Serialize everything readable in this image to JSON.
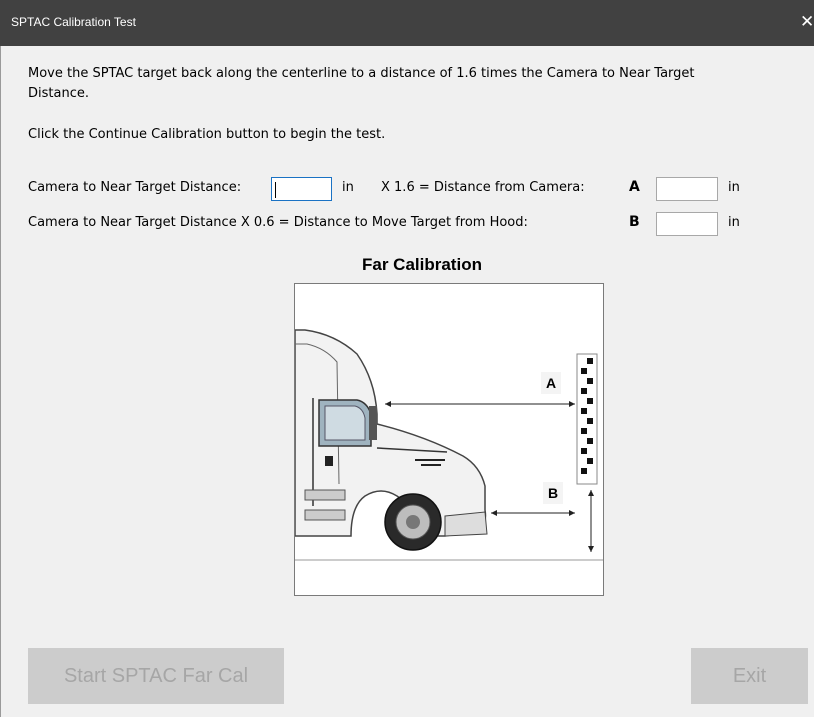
{
  "window": {
    "title": "SPTAC Calibration Test",
    "close_glyph": "✕"
  },
  "instructions": {
    "line1": "Move the SPTAC target back along the centerline to a distance of 1.6 times the Camera to Near Target",
    "line1_cont": "Distance.",
    "line2": "Click the Continue Calibration button to begin the test."
  },
  "row1": {
    "label": "Camera to Near Target Distance:",
    "input_value": "",
    "unit": "in",
    "formula": "X 1.6 = Distance from Camera:",
    "letter": "A",
    "result_value": "",
    "result_unit": "in"
  },
  "row2": {
    "label": "Camera to Near Target Distance X 0.6 = Distance to Move Target from Hood:",
    "letter": "B",
    "result_value": "",
    "result_unit": "in"
  },
  "figure": {
    "title": "Far Calibration",
    "label_a": "A",
    "label_b": "B"
  },
  "buttons": {
    "start": "Start SPTAC Far Cal",
    "exit": "Exit"
  }
}
